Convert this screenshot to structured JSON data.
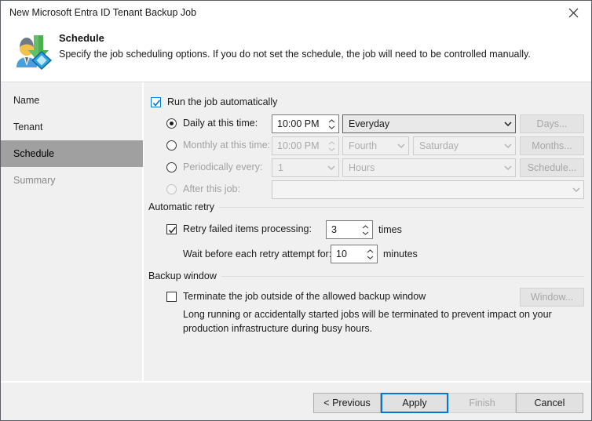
{
  "window": {
    "title": "New Microsoft Entra ID Tenant Backup Job",
    "close_icon": "close-icon"
  },
  "header": {
    "icon": "entra-id-tenant-backup-icon",
    "title": "Schedule",
    "subtitle": "Specify the job scheduling options. If you do not set the schedule, the job will need to be controlled manually."
  },
  "sidebar": {
    "items": [
      {
        "label": "Name",
        "state": "enabled"
      },
      {
        "label": "Tenant",
        "state": "enabled"
      },
      {
        "label": "Schedule",
        "state": "active"
      },
      {
        "label": "Summary",
        "state": "disabled"
      }
    ]
  },
  "main": {
    "run_automatically": {
      "label": "Run the job automatically",
      "checked": true
    },
    "daily": {
      "label": "Daily at this time:",
      "selected": true,
      "time": "10:00 PM",
      "frequency": "Everyday",
      "button": "Days..."
    },
    "monthly": {
      "label": "Monthly at this time:",
      "selected": false,
      "time": "10:00 PM",
      "week": "Fourth",
      "day": "Saturday",
      "button": "Months..."
    },
    "periodically": {
      "label": "Periodically every:",
      "selected": false,
      "interval": "1",
      "unit": "Hours",
      "button": "Schedule..."
    },
    "after_job": {
      "label": "After this job:",
      "selected": false,
      "value": ""
    },
    "automatic_retry": {
      "group_label": "Automatic retry",
      "retry_label": "Retry failed items processing:",
      "retry_checked": true,
      "retry_times": "3",
      "retry_times_unit": "times",
      "wait_label": "Wait before each retry attempt for:",
      "wait_value": "10",
      "wait_unit": "minutes"
    },
    "backup_window": {
      "group_label": "Backup window",
      "terminate_label": "Terminate the job outside of the allowed backup window",
      "terminate_checked": false,
      "description": "Long running or accidentally started jobs will be terminated to prevent impact on your production infrastructure during busy hours.",
      "button": "Window..."
    }
  },
  "footer": {
    "previous": "< Previous",
    "apply": "Apply",
    "finish": "Finish",
    "cancel": "Cancel"
  },
  "colors": {
    "accent": "#0078d7",
    "sidebar_active": "#a0a0a0",
    "surface": "#f0f0f0"
  }
}
